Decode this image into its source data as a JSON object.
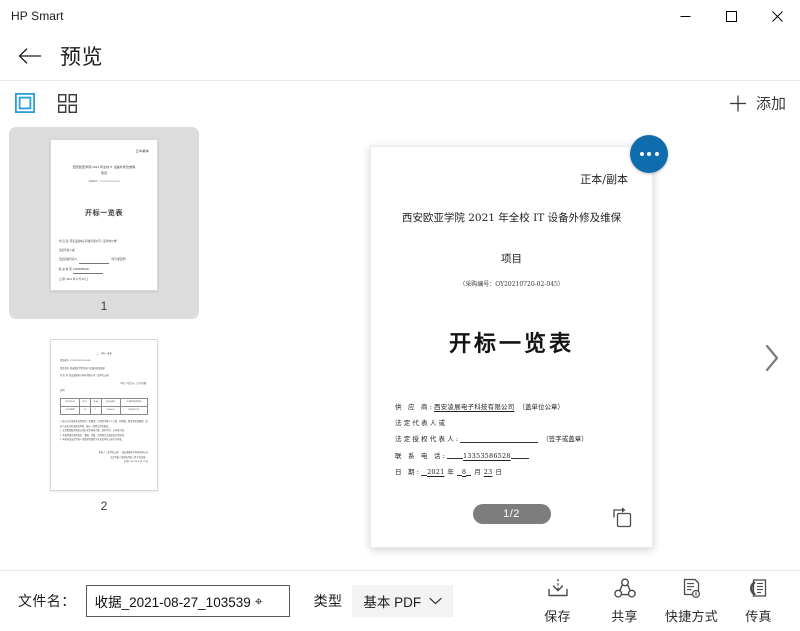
{
  "window": {
    "title": "HP Smart",
    "controls": {
      "minimize": "minimize-icon",
      "maximize": "maximize-icon",
      "close": "close-icon"
    }
  },
  "header": {
    "back_icon": "back-arrow-icon",
    "title": "预览"
  },
  "toolbar": {
    "view_single_icon": "single-page-view-icon",
    "view_grid_icon": "grid-view-icon",
    "add_icon": "plus-icon",
    "add_label": "添加",
    "selected_view": "single"
  },
  "thumbnails": [
    {
      "label": "1",
      "selected": true
    },
    {
      "label": "2",
      "selected": false
    }
  ],
  "preview": {
    "more_icon": "ellipsis-icon",
    "next_icon": "chevron-right-icon",
    "rotate_icon": "rotate-clockwise-icon",
    "page_indicator": "1/2",
    "document": {
      "copy_mark": "正本/副本",
      "title_line1": "西安欧亚学院 2021 年全校 IT 设备外修及维保",
      "title_line2": "项目",
      "purchase_code": "（采购编号：OY20210720-02-045）",
      "main_title": "开标一览表",
      "fields": [
        {
          "label": "供  应  商:",
          "value": "西安凌展电子科技有限公司",
          "tail": "（盖单位公章）"
        },
        {
          "label": "法定代表人或",
          "value": "",
          "tail": ""
        },
        {
          "label": "法定授权代表人:",
          "value": "",
          "tail": "（签字或盖章）"
        },
        {
          "label": "联 系 电 话:",
          "value": "13353586528",
          "tail": ""
        }
      ],
      "date": {
        "label": "日      期:",
        "year": "2021",
        "year_unit": "年",
        "month": "8",
        "month_unit": "月",
        "day": "23",
        "day_unit": "日"
      }
    },
    "thumb1": {
      "copy_mark": "正本/副本",
      "title_line1": "西安欧亚学院 2021 年全校 IT 设备外修及维保",
      "title_line2": "项目",
      "purchase_code": "（采购编号：OY20210720-02-045）",
      "main_title": "开标一览表",
      "f1": "供  应  商: 西安凌展电子科技有限公司（盖单位公章）",
      "f2": "法定代表人或",
      "f3": "法定授权代表人:",
      "f3tail": "（签字或盖章）",
      "f4": "联 系 电 话:",
      "f4val": "13353586528",
      "f5": "日      期:  2021 年  8  月  23  日"
    },
    "thumb2": {
      "heading": "二、开标一览表",
      "l1": "项目编号: OY20210720-02-045",
      "l2": "项目名称: 西安欧亚学院全校IT设备外修及维保",
      "l3": "供 应 商: 西安凌展电子科技有限公司（盖单位公章）",
      "l4": "单位: 人民币元（大写金额）",
      "l5": "说明:",
      "table_headers": [
        "序号及名称",
        "单 位",
        "数 量",
        "投标总报价",
        "交货期及服务承诺"
      ],
      "table_row": [
        "IT设备维保",
        "项",
        "1",
        "89000.00",
        "详见投标文件"
      ],
      "n1": "1. 报价为完成本项目所需的一切费用，包括但不限于人工费、材料费、税金等全部费用，投标人应充分考虑各项风险，报价一经提交不得更改。",
      "n2": "2. 交货期及服务承诺以投标文件承诺为准，如有不符，以本表为准。",
      "n3": "3. 本表所填内容须真实、准确、完整，否则视为无效投标文件处理。",
      "n4": "4. 本表须由法定代表人或授权代表签字并加盖单位公章方为有效。",
      "s1": "投标人（盖单位公章）: 西安凌展电子科技有限公司",
      "s2": "法定代表人或授权代表（签字或盖章）:",
      "s3": "日    期: 2021 年 8 月 23 日"
    }
  },
  "bottom": {
    "filename_label": "文件名：",
    "filename_value": "收据_2021-08-27_103539",
    "filename_placeholder": "文件名",
    "type_label": "类型",
    "type_value": "基本 PDF",
    "type_chevron": "chevron-down-icon",
    "actions": [
      {
        "label": "保存",
        "icon": "download-icon"
      },
      {
        "label": "共享",
        "icon": "share-icon"
      },
      {
        "label": "快捷方式",
        "icon": "shortcut-document-icon"
      },
      {
        "label": "传真",
        "icon": "fax-icon"
      }
    ]
  },
  "colors": {
    "accent_blue": "#0f6cad",
    "toggle_blue": "#2a9fd6",
    "pill_gray": "#7d7d7d",
    "selected_thumb_bg": "#dcdcdc"
  }
}
